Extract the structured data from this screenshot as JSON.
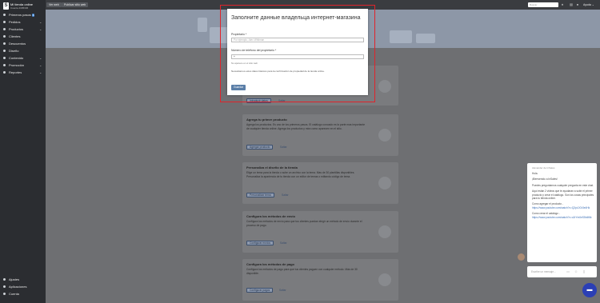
{
  "brand": {
    "logo_letter": "S",
    "name": "Mi tienda online",
    "sub": "Cuenta 4305336"
  },
  "sidebar": {
    "items": [
      {
        "label": "Primeros pasos",
        "badge": "6"
      },
      {
        "label": "Pedidos",
        "chevron": "⌄"
      },
      {
        "label": "Productos",
        "chevron": "⌄"
      },
      {
        "label": "Clientes"
      },
      {
        "label": "Descuentos"
      },
      {
        "label": "Diseño"
      },
      {
        "label": "Contenido",
        "chevron": "⌄"
      },
      {
        "label": "Promoción",
        "chevron": "⌄"
      },
      {
        "label": "Reportes",
        "chevron": "⌄"
      }
    ],
    "bottom": [
      {
        "label": "Ajustes"
      },
      {
        "label": "Aplicaciones"
      },
      {
        "label": "Cuenta"
      }
    ]
  },
  "topbar": {
    "view_site": "Ver web",
    "publish_site": "Publicar sitio web",
    "search_placeholder": "Buscar",
    "help": "Ayuda"
  },
  "cards": [
    {
      "title": "",
      "desc": "",
      "button": "Introducir datos",
      "skip": "Saltar"
    },
    {
      "title": "Agrega tu primer producto",
      "desc": "Agrega los productos. Es uno de los primeros pasos. El catálogo conoado es la parte mas importante de cualquier tienda online. Agrega los productos y mira como aparecen en el sitio.",
      "button": "Agregar producto",
      "skip": "Saltar"
    },
    {
      "title": "Personaliza el diseño de la tienda",
      "desc": "Elige un tema para la tienda o sube un archivo con la tema. Mas de 30 plantillas disponibles. Personaliza la apariencia de tu tienda con un editor de temas o editando código de tema.",
      "button": "Personalizar tema",
      "skip": "Saltar"
    },
    {
      "title": "Configura los métodos de envío",
      "desc": "Configura los métodos de envío para que tus clientes puedan elegir un método de envío durante el proceso de pago.",
      "button": "Configurar envíos",
      "skip": "Saltar"
    },
    {
      "title": "Configura los métodos de pago",
      "desc": "Configura los métodos de pago para que tus clientes paguen con cualquier método. Más de 30 disponible.",
      "button": "Configurar pagos",
      "skip": "Saltar"
    }
  ],
  "modal": {
    "title": "Заполните данные владельца интернет-магазина",
    "owner_label": "Propietario *",
    "owner_placeholder": "Por ejemplo, Alex Whitman",
    "phone_label": "Número de teléfono del propietario *",
    "phone_value": "+",
    "phone_help": "No aparece en el sitio web",
    "note": "Necesitamos estos datos básicos para la confirmación de propiedad de la tienda online.",
    "save": "Guardar"
  },
  "chat": {
    "who": "Alexander de InSales",
    "messages": [
      "Hola.",
      "¡Bienvenido a InSales!",
      "Puedes preguntarnos cualquier pregunta en este chat.",
      "Aquí están 2 videos que te ayudaran a subir el primer producto y crear el catálogo. Son los cosas principales para tu tienda online."
    ],
    "links": [
      {
        "label": "Como agregar el producto -",
        "url": "https://www.youtube.com/watch?v=Q2pL0Gr3e4Hk"
      },
      {
        "label": "Como crear el catálogo -",
        "url": "https://www.youtube.com/watch?v=o2rYm0eS5b4f6k"
      }
    ],
    "input_placeholder": "Escribe un mensaje..."
  },
  "colors": {
    "accent_red": "#e0232b",
    "chat_fab": "#2b3fb5",
    "save_button": "#5b7fa8"
  }
}
